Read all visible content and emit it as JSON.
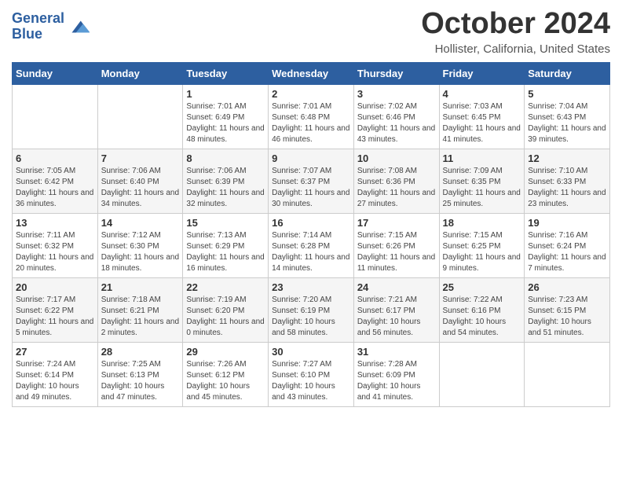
{
  "header": {
    "logo_line1": "General",
    "logo_line2": "Blue",
    "month_title": "October 2024",
    "location": "Hollister, California, United States"
  },
  "weekdays": [
    "Sunday",
    "Monday",
    "Tuesday",
    "Wednesday",
    "Thursday",
    "Friday",
    "Saturday"
  ],
  "weeks": [
    [
      {
        "day": "",
        "sunrise": "",
        "sunset": "",
        "daylight": ""
      },
      {
        "day": "",
        "sunrise": "",
        "sunset": "",
        "daylight": ""
      },
      {
        "day": "1",
        "sunrise": "Sunrise: 7:01 AM",
        "sunset": "Sunset: 6:49 PM",
        "daylight": "Daylight: 11 hours and 48 minutes."
      },
      {
        "day": "2",
        "sunrise": "Sunrise: 7:01 AM",
        "sunset": "Sunset: 6:48 PM",
        "daylight": "Daylight: 11 hours and 46 minutes."
      },
      {
        "day": "3",
        "sunrise": "Sunrise: 7:02 AM",
        "sunset": "Sunset: 6:46 PM",
        "daylight": "Daylight: 11 hours and 43 minutes."
      },
      {
        "day": "4",
        "sunrise": "Sunrise: 7:03 AM",
        "sunset": "Sunset: 6:45 PM",
        "daylight": "Daylight: 11 hours and 41 minutes."
      },
      {
        "day": "5",
        "sunrise": "Sunrise: 7:04 AM",
        "sunset": "Sunset: 6:43 PM",
        "daylight": "Daylight: 11 hours and 39 minutes."
      }
    ],
    [
      {
        "day": "6",
        "sunrise": "Sunrise: 7:05 AM",
        "sunset": "Sunset: 6:42 PM",
        "daylight": "Daylight: 11 hours and 36 minutes."
      },
      {
        "day": "7",
        "sunrise": "Sunrise: 7:06 AM",
        "sunset": "Sunset: 6:40 PM",
        "daylight": "Daylight: 11 hours and 34 minutes."
      },
      {
        "day": "8",
        "sunrise": "Sunrise: 7:06 AM",
        "sunset": "Sunset: 6:39 PM",
        "daylight": "Daylight: 11 hours and 32 minutes."
      },
      {
        "day": "9",
        "sunrise": "Sunrise: 7:07 AM",
        "sunset": "Sunset: 6:37 PM",
        "daylight": "Daylight: 11 hours and 30 minutes."
      },
      {
        "day": "10",
        "sunrise": "Sunrise: 7:08 AM",
        "sunset": "Sunset: 6:36 PM",
        "daylight": "Daylight: 11 hours and 27 minutes."
      },
      {
        "day": "11",
        "sunrise": "Sunrise: 7:09 AM",
        "sunset": "Sunset: 6:35 PM",
        "daylight": "Daylight: 11 hours and 25 minutes."
      },
      {
        "day": "12",
        "sunrise": "Sunrise: 7:10 AM",
        "sunset": "Sunset: 6:33 PM",
        "daylight": "Daylight: 11 hours and 23 minutes."
      }
    ],
    [
      {
        "day": "13",
        "sunrise": "Sunrise: 7:11 AM",
        "sunset": "Sunset: 6:32 PM",
        "daylight": "Daylight: 11 hours and 20 minutes."
      },
      {
        "day": "14",
        "sunrise": "Sunrise: 7:12 AM",
        "sunset": "Sunset: 6:30 PM",
        "daylight": "Daylight: 11 hours and 18 minutes."
      },
      {
        "day": "15",
        "sunrise": "Sunrise: 7:13 AM",
        "sunset": "Sunset: 6:29 PM",
        "daylight": "Daylight: 11 hours and 16 minutes."
      },
      {
        "day": "16",
        "sunrise": "Sunrise: 7:14 AM",
        "sunset": "Sunset: 6:28 PM",
        "daylight": "Daylight: 11 hours and 14 minutes."
      },
      {
        "day": "17",
        "sunrise": "Sunrise: 7:15 AM",
        "sunset": "Sunset: 6:26 PM",
        "daylight": "Daylight: 11 hours and 11 minutes."
      },
      {
        "day": "18",
        "sunrise": "Sunrise: 7:15 AM",
        "sunset": "Sunset: 6:25 PM",
        "daylight": "Daylight: 11 hours and 9 minutes."
      },
      {
        "day": "19",
        "sunrise": "Sunrise: 7:16 AM",
        "sunset": "Sunset: 6:24 PM",
        "daylight": "Daylight: 11 hours and 7 minutes."
      }
    ],
    [
      {
        "day": "20",
        "sunrise": "Sunrise: 7:17 AM",
        "sunset": "Sunset: 6:22 PM",
        "daylight": "Daylight: 11 hours and 5 minutes."
      },
      {
        "day": "21",
        "sunrise": "Sunrise: 7:18 AM",
        "sunset": "Sunset: 6:21 PM",
        "daylight": "Daylight: 11 hours and 2 minutes."
      },
      {
        "day": "22",
        "sunrise": "Sunrise: 7:19 AM",
        "sunset": "Sunset: 6:20 PM",
        "daylight": "Daylight: 11 hours and 0 minutes."
      },
      {
        "day": "23",
        "sunrise": "Sunrise: 7:20 AM",
        "sunset": "Sunset: 6:19 PM",
        "daylight": "Daylight: 10 hours and 58 minutes."
      },
      {
        "day": "24",
        "sunrise": "Sunrise: 7:21 AM",
        "sunset": "Sunset: 6:17 PM",
        "daylight": "Daylight: 10 hours and 56 minutes."
      },
      {
        "day": "25",
        "sunrise": "Sunrise: 7:22 AM",
        "sunset": "Sunset: 6:16 PM",
        "daylight": "Daylight: 10 hours and 54 minutes."
      },
      {
        "day": "26",
        "sunrise": "Sunrise: 7:23 AM",
        "sunset": "Sunset: 6:15 PM",
        "daylight": "Daylight: 10 hours and 51 minutes."
      }
    ],
    [
      {
        "day": "27",
        "sunrise": "Sunrise: 7:24 AM",
        "sunset": "Sunset: 6:14 PM",
        "daylight": "Daylight: 10 hours and 49 minutes."
      },
      {
        "day": "28",
        "sunrise": "Sunrise: 7:25 AM",
        "sunset": "Sunset: 6:13 PM",
        "daylight": "Daylight: 10 hours and 47 minutes."
      },
      {
        "day": "29",
        "sunrise": "Sunrise: 7:26 AM",
        "sunset": "Sunset: 6:12 PM",
        "daylight": "Daylight: 10 hours and 45 minutes."
      },
      {
        "day": "30",
        "sunrise": "Sunrise: 7:27 AM",
        "sunset": "Sunset: 6:10 PM",
        "daylight": "Daylight: 10 hours and 43 minutes."
      },
      {
        "day": "31",
        "sunrise": "Sunrise: 7:28 AM",
        "sunset": "Sunset: 6:09 PM",
        "daylight": "Daylight: 10 hours and 41 minutes."
      },
      {
        "day": "",
        "sunrise": "",
        "sunset": "",
        "daylight": ""
      },
      {
        "day": "",
        "sunrise": "",
        "sunset": "",
        "daylight": ""
      }
    ]
  ]
}
